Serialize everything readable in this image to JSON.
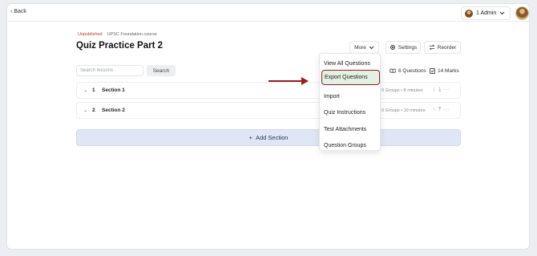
{
  "topbar": {
    "back_label": "Back",
    "admin_label": "1 Admin"
  },
  "breadcrumb": {
    "status": "Unpublished",
    "course": "UPSC Foundation course"
  },
  "page": {
    "title": "Quiz Practice Part 2"
  },
  "actions": {
    "more": "More",
    "settings": "Settings",
    "reorder": "Reorder"
  },
  "search": {
    "placeholder": "Search lessons",
    "button": "Search"
  },
  "stats": {
    "questions": "6 Questions",
    "marks": "14 Marks"
  },
  "sections": [
    {
      "num": "1",
      "name": "Section 1",
      "meta": "0 Groups  •  8 minutes"
    },
    {
      "num": "2",
      "name": "Section 2",
      "meta": "0 Groups  •  10 minutes"
    }
  ],
  "add_section": "Add Section",
  "menu": {
    "items": [
      "View All Questions",
      "Export Questions",
      "Import",
      "Quiz Instructions",
      "Test Attachments",
      "Question Groups"
    ],
    "highlighted": "Export Questions"
  },
  "colors": {
    "accent": "#9b1c1c",
    "unpublished": "#c0392b",
    "add_section_bg": "#dfe6f5",
    "highlight_bg": "#e3f1e3"
  },
  "icons": [
    "chevron-left-icon",
    "chevron-down-icon",
    "gear-icon",
    "reorder-icon",
    "book-icon",
    "check-square-icon",
    "arrow-down-icon",
    "arrow-up-icon",
    "more-dots-icon",
    "plus-icon",
    "pointer-arrow-icon"
  ]
}
